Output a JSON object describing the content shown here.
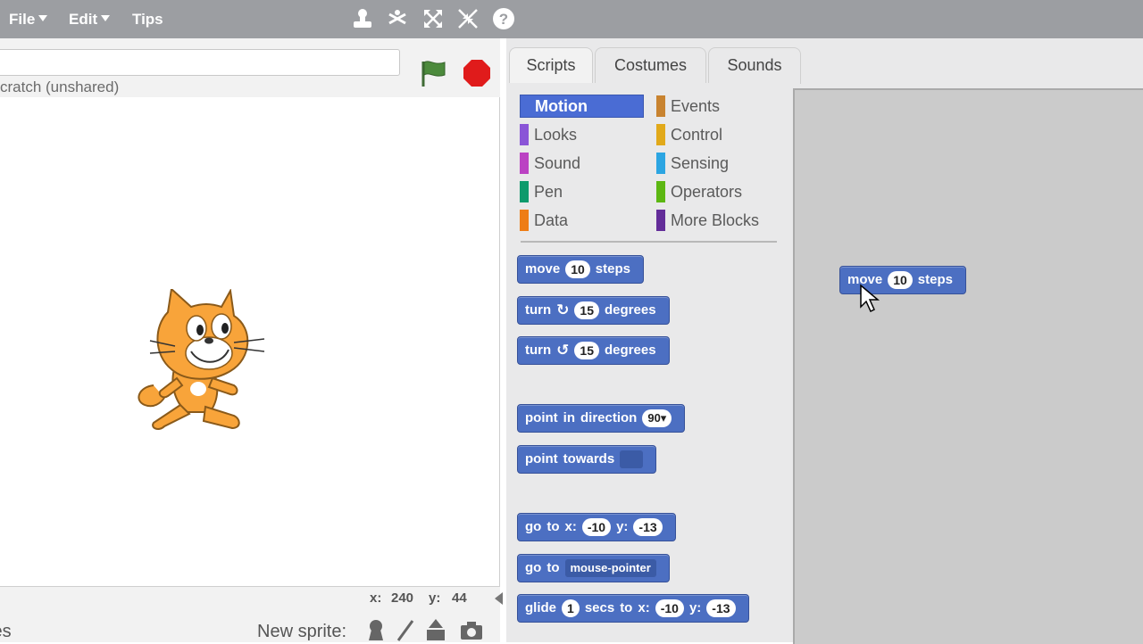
{
  "menu": {
    "file": "File",
    "edit": "Edit",
    "tips": "Tips"
  },
  "toolbar_icons": [
    "duplicate-stamp-icon",
    "cut-scissors-icon",
    "grow-icon",
    "shrink-icon",
    "help-icon"
  ],
  "stage": {
    "project_title": "",
    "project_owner": "cratch (unshared)",
    "coords": {
      "x_label": "x:",
      "x_value": "240",
      "y_label": "y:",
      "y_value": "44"
    },
    "sprites_label": "tes",
    "new_sprite_label": "New sprite:"
  },
  "tabs": {
    "scripts": "Scripts",
    "costumes": "Costumes",
    "sounds": "Sounds"
  },
  "categories": [
    {
      "label": "Motion",
      "color": "#4a6cd4",
      "selected": true
    },
    {
      "label": "Looks",
      "color": "#8a55d7"
    },
    {
      "label": "Sound",
      "color": "#bb42c3"
    },
    {
      "label": "Pen",
      "color": "#0e9a6c"
    },
    {
      "label": "Data",
      "color": "#ee7d16"
    },
    {
      "label": "Events",
      "color": "#c88330"
    },
    {
      "label": "Control",
      "color": "#e1a91a"
    },
    {
      "label": "Sensing",
      "color": "#2ca5e2"
    },
    {
      "label": "Operators",
      "color": "#5cb712"
    },
    {
      "label": "More Blocks",
      "color": "#632d99"
    }
  ],
  "blocks": {
    "move": {
      "w1": "move",
      "val": "10",
      "w2": "steps"
    },
    "turn_right": {
      "w1": "turn",
      "val": "15",
      "w2": "degrees"
    },
    "turn_left": {
      "w1": "turn",
      "val": "15",
      "w2": "degrees"
    },
    "point_direction": {
      "w1": "point",
      "w2": "in",
      "w3": "direction",
      "val": "90▾"
    },
    "point_towards": {
      "w1": "point",
      "w2": "towards",
      "val": ""
    },
    "go_to_xy": {
      "w1": "go",
      "w2": "to",
      "w3": "x:",
      "x": "-10",
      "w4": "y:",
      "y": "-13"
    },
    "go_to": {
      "w1": "go",
      "w2": "to",
      "val": "mouse-pointer"
    },
    "glide": {
      "w1": "glide",
      "secs": "1",
      "w2": "secs",
      "w3": "to",
      "w4": "x:",
      "x": "-10",
      "w5": "y:",
      "y": "-13"
    }
  },
  "script_area": {
    "move": {
      "w1": "move",
      "val": "10",
      "w2": "steps"
    }
  }
}
